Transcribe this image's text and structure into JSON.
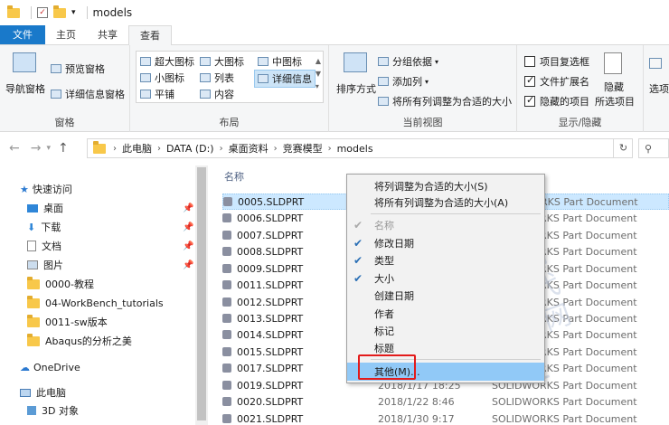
{
  "window": {
    "title": "models"
  },
  "tabs": [
    "文件",
    "主页",
    "共享",
    "查看"
  ],
  "ribbon": {
    "panes": {
      "nav_pane": "导航窗格",
      "preview_pane": "预览窗格",
      "details_pane": "详细信息窗格",
      "group_label": "窗格"
    },
    "layout": {
      "items": [
        "超大图标",
        "大图标",
        "中图标",
        "小图标",
        "列表",
        "详细信息",
        "平铺",
        "内容"
      ],
      "group_label": "布局"
    },
    "current_view": {
      "sort_label": "排序方式",
      "group_by": "分组依据",
      "add_columns": "添加列",
      "fit_columns": "将所有列调整为合适的大小",
      "group_label": "当前视图"
    },
    "show_hide": {
      "item_checkbox": "项目复选框",
      "file_ext": "文件扩展名",
      "hidden_items": "隐藏的项目",
      "hide_label": "隐藏",
      "selected_items": "所选项目",
      "options": "选项",
      "group_label": "显示/隐藏"
    }
  },
  "address": {
    "crumbs": [
      "此电脑",
      "DATA (D:)",
      "桌面资料",
      "竞赛模型",
      "models"
    ]
  },
  "sidebar": {
    "quick_access": "快速访问",
    "items": [
      "桌面",
      "下载",
      "文档",
      "图片",
      "0000-教程",
      "04-WorkBench_tutorials",
      "0011-sw版本",
      "Abaqus的分析之美"
    ],
    "onedrive": "OneDrive",
    "this_pc": "此电脑",
    "objects3d": "3D 对象"
  },
  "files": {
    "col_name": "名称",
    "rows": [
      {
        "name": "0005.SLDPRT",
        "date": "",
        "type": "SOLIDWORKS Part Document"
      },
      {
        "name": "0006.SLDPRT",
        "date": "",
        "type": "SOLIDWORKS Part Document"
      },
      {
        "name": "0007.SLDPRT",
        "date": "",
        "type": "SOLIDWORKS Part Document"
      },
      {
        "name": "0008.SLDPRT",
        "date": "",
        "type": "SOLIDWORKS Part Document"
      },
      {
        "name": "0009.SLDPRT",
        "date": "",
        "type": "SOLIDWORKS Part Document"
      },
      {
        "name": "0011.SLDPRT",
        "date": "",
        "type": "SOLIDWORKS Part Document"
      },
      {
        "name": "0012.SLDPRT",
        "date": "",
        "type": "SOLIDWORKS Part Document"
      },
      {
        "name": "0013.SLDPRT",
        "date": "",
        "type": "SOLIDWORKS Part Document"
      },
      {
        "name": "0014.SLDPRT",
        "date": "",
        "type": "SOLIDWORKS Part Document"
      },
      {
        "name": "0015.SLDPRT",
        "date": "",
        "type": "SOLIDWORKS Part Document"
      },
      {
        "name": "0017.SLDPRT",
        "date": "",
        "type": "SOLIDWORKS Part Document"
      },
      {
        "name": "0019.SLDPRT",
        "date": "2018/1/17 18:25",
        "type": "SOLIDWORKS Part Document"
      },
      {
        "name": "0020.SLDPRT",
        "date": "2018/1/22 8:46",
        "type": "SOLIDWORKS Part Document"
      },
      {
        "name": "0021.SLDPRT",
        "date": "2018/1/30 9:17",
        "type": "SOLIDWORKS Part Document"
      }
    ]
  },
  "watermark": "机械时代网 www.jxasjd",
  "context_menu": {
    "fit_col": "将列调整为合适的大小(S)",
    "fit_all": "将所有列调整为合适的大小(A)",
    "items": [
      {
        "label": "名称",
        "checked": true,
        "disabled": true
      },
      {
        "label": "修改日期",
        "checked": true,
        "disabled": false
      },
      {
        "label": "类型",
        "checked": true,
        "disabled": false
      },
      {
        "label": "大小",
        "checked": true,
        "disabled": false
      },
      {
        "label": "创建日期",
        "checked": false,
        "disabled": false
      },
      {
        "label": "作者",
        "checked": false,
        "disabled": false
      },
      {
        "label": "标记",
        "checked": false,
        "disabled": false
      },
      {
        "label": "标题",
        "checked": false,
        "disabled": false
      }
    ],
    "more": "其他(M)..."
  },
  "colors": {
    "accent": "#1979ca",
    "highlight": "#91c9f7",
    "callout": "#e31b1b"
  }
}
